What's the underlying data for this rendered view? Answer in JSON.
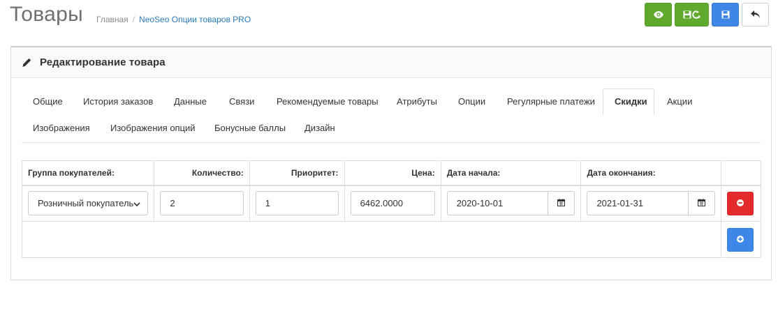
{
  "header": {
    "title": "Товары",
    "breadcrumb": {
      "home": "Главная",
      "separator": "/",
      "current": "NeoSeo Опции товаров PRO"
    }
  },
  "toolbar": {
    "buttons": [
      {
        "icon": "eye-icon",
        "color": "#5fa92f"
      },
      {
        "icon": "save-refresh-icon",
        "color": "#5fa92f"
      },
      {
        "icon": "floppy-disk-icon",
        "color": "#3f87e6"
      },
      {
        "icon": "reply-arrow-icon",
        "color": "#ffffff"
      }
    ]
  },
  "panel": {
    "title": "Редактирование товара",
    "icon": "pencil-icon"
  },
  "tabs": [
    {
      "label": "Общие"
    },
    {
      "label": "История заказов"
    },
    {
      "label": "Данные"
    },
    {
      "label": "Связи"
    },
    {
      "label": "Рекомендуемые товары"
    },
    {
      "label": "Атрибуты"
    },
    {
      "label": "Опции"
    },
    {
      "label": "Регулярные платежи"
    },
    {
      "label": "Скидки",
      "active": true
    },
    {
      "label": "Акции"
    },
    {
      "label": "Изображения"
    },
    {
      "label": "Изображения опций"
    },
    {
      "label": "Бонусные баллы"
    },
    {
      "label": "Дизайн"
    }
  ],
  "discount_table": {
    "columns": [
      "Группа покупателей:",
      "Количество:",
      "Приоритет:",
      "Цена:",
      "Дата начала:",
      "Дата окончания:"
    ],
    "rows": [
      {
        "customer_group": "Розничный покупатель",
        "quantity": "2",
        "priority": "1",
        "price": "6462.0000",
        "date_start": "2020-10-01",
        "date_end": "2021-01-31"
      }
    ]
  },
  "colors": {
    "success": "#5fa92f",
    "primary": "#3f87e6",
    "danger": "#e42a2a",
    "link": "#2a7ab8"
  }
}
